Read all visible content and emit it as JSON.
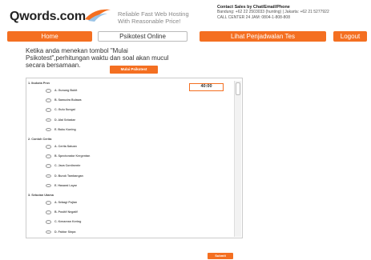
{
  "header": {
    "logo_text": "Qwords.com",
    "tagline_line1": "Reliable Fast Web Hosting",
    "tagline_line2": "With Reasonable Price!",
    "contact_title": "Contact Sales by Chat/Email/Phone",
    "contact_bandung": "Bandung: +62 22 2503033 (hunting) | Jakarta: +62 21 5277922",
    "contact_callcenter": "CALL CENTER 24 JAM: 0804-1-808-808"
  },
  "nav": {
    "items": [
      {
        "label": "Home"
      },
      {
        "label": "Psikotest Online"
      },
      {
        "label": "Lihat Penjadwalan Tes"
      },
      {
        "label": "Logout"
      }
    ]
  },
  "instruction": {
    "line1": "Ketika anda menekan tombol \"Mulai",
    "line2": "Psikotest\",perhitungan  waktu dan soal akan mucul",
    "line3": "secara bersamaan."
  },
  "start_button": {
    "label": "Mulai Psikotest"
  },
  "timer": {
    "value": "40:00"
  },
  "questions": [
    {
      "text": "1. Ibukota Prov",
      "options": [
        "A. Gunung Bukit",
        "B. Samudra Bulawa",
        "C. Gulu Sungai",
        "D. Alai Sebakar",
        "E. Buku Kuning"
      ]
    },
    {
      "text": "2. Contoh Cerita",
      "options": [
        "A. Cerita Satuan",
        "B. Spectonator Kergentan",
        "C. Java Continente",
        "D. Buruk Tambangan",
        "E. Hasarai Layar"
      ]
    },
    {
      "text": "3. Sebutan Utama",
      "options": [
        "A. Sebagi Pujian",
        "B. Positif Negatif",
        "C. Kenarean Kering",
        "D. Faktor Sinpa",
        "E. Martnaro Singa"
      ]
    }
  ],
  "submit_button": {
    "label": "Submit"
  },
  "colors": {
    "accent": "#f46f21"
  }
}
